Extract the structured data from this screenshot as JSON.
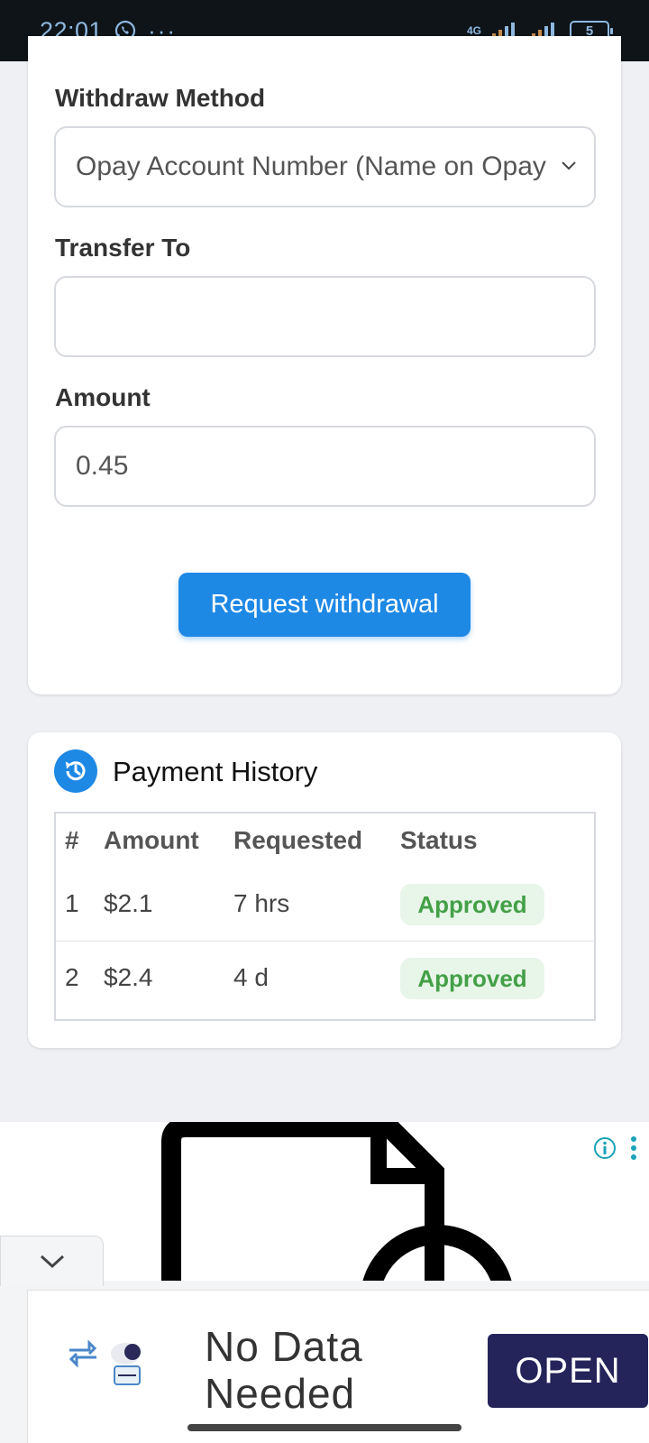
{
  "status_bar": {
    "time": "22:01",
    "network_label": "4G",
    "battery": "5",
    "icons": [
      "whatsapp-icon",
      "more-dots-icon",
      "signal-icon",
      "battery-icon"
    ]
  },
  "form": {
    "withdraw_method_label": "Withdraw Method",
    "withdraw_method_value": "Opay Account Number (Name on Opay",
    "transfer_to_label": "Transfer To",
    "transfer_to_value": "",
    "amount_label": "Amount",
    "amount_value": "0.45",
    "submit_label": "Request withdrawal"
  },
  "history": {
    "title": "Payment History",
    "columns": [
      "#",
      "Amount",
      "Requested",
      "Status"
    ],
    "rows": [
      {
        "index": "1",
        "amount": "$2.1",
        "requested": "7 hrs",
        "status": "Approved"
      },
      {
        "index": "2",
        "amount": "$2.4",
        "requested": "4 d",
        "status": "Approved"
      }
    ]
  },
  "ad": {
    "headline": "No Data Needed",
    "cta": "OPEN"
  },
  "colors": {
    "primary": "#1e88e5",
    "approved_text": "#43a047",
    "approved_bg": "#e8f5e9",
    "ad_cta_bg": "#24245a"
  }
}
